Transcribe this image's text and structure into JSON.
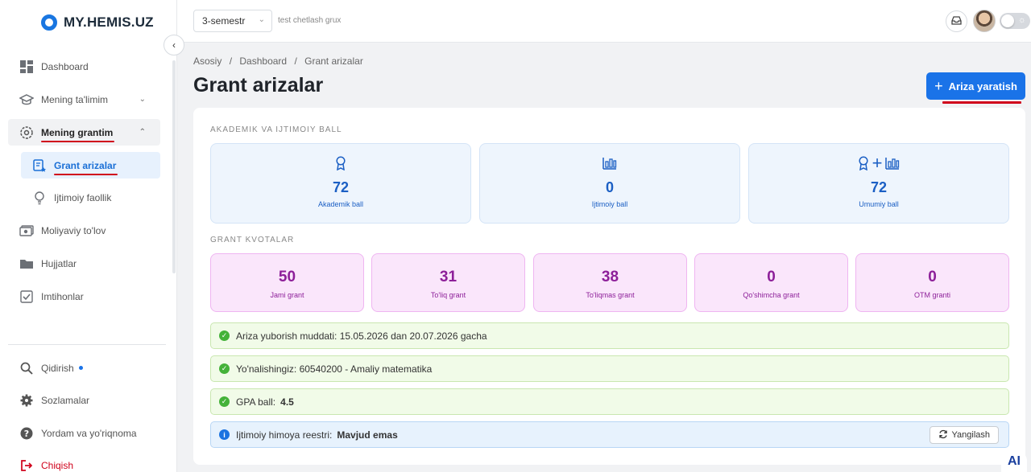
{
  "brand": {
    "logo_text": "MY.HEMIS.UZ"
  },
  "sidebar": {
    "items": [
      {
        "label": "Dashboard"
      },
      {
        "label": "Mening ta'limim"
      },
      {
        "label": "Mening grantim"
      },
      {
        "label": "Grant arizalar"
      },
      {
        "label": "Ijtimoiy faollik"
      },
      {
        "label": "Moliyaviy to'lov"
      },
      {
        "label": "Hujjatlar"
      },
      {
        "label": "Imtihonlar"
      }
    ],
    "bottom": [
      {
        "label": "Qidirish"
      },
      {
        "label": "Sozlamalar"
      },
      {
        "label": "Yordam va yo'riqnoma"
      },
      {
        "label": "Chiqish"
      }
    ]
  },
  "topbar": {
    "semester": "3-semestr",
    "group": "test chetlash grux"
  },
  "breadcrumb": [
    "Asosiy",
    "/",
    "Dashboard",
    "/",
    "Grant arizalar"
  ],
  "page": {
    "title": "Grant arizalar",
    "create_button": "Ariza yaratish"
  },
  "scores": {
    "section_label": "AKADEMIK VA IJTIMOIY BALL",
    "items": [
      {
        "value": "72",
        "label": "Akademik ball"
      },
      {
        "value": "0",
        "label": "Ijtimoiy ball"
      },
      {
        "value": "72",
        "label": "Umumiy ball"
      }
    ]
  },
  "quotas": {
    "section_label": "GRANT KVOTALAR",
    "items": [
      {
        "value": "50",
        "label": "Jami grant"
      },
      {
        "value": "31",
        "label": "To'liq grant"
      },
      {
        "value": "38",
        "label": "To'liqmas grant"
      },
      {
        "value": "0",
        "label": "Qo'shimcha grant"
      },
      {
        "value": "0",
        "label": "OTM granti"
      }
    ]
  },
  "alerts": {
    "deadline": "Ariza yuborish muddati: 15.05.2026 dan 20.07.2026 gacha",
    "direction": "Yo'nalishingiz: 60540200 - Amaliy matematika",
    "gpa_label": "GPA ball:",
    "gpa_value": "4.5",
    "registry_label": "Ijtimoiy himoya reestri:",
    "registry_value": "Mavjud emas",
    "refresh_button": "Yangilash"
  },
  "ai_badge": "AI",
  "colors": {
    "primary": "#1a73e8",
    "annotation_red": "#d0021b",
    "score_text": "#1b5fc4",
    "quota_text": "#8d1f99",
    "success": "#44b239"
  }
}
